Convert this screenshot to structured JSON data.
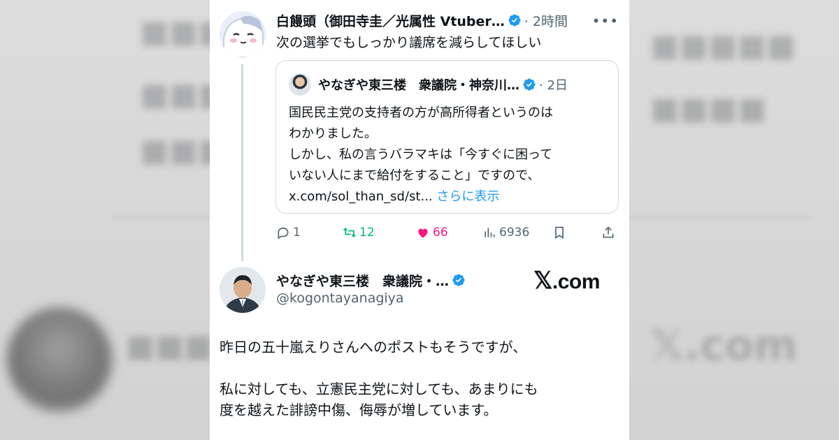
{
  "reply": {
    "author": "白饅頭（御田寺圭／光属性 Vtuber…",
    "time": "· 2時間",
    "text": "次の選挙でもしっかり議席を減らしてほしい"
  },
  "quote": {
    "author": "やなぎや東三楼　衆議院・神奈川…",
    "time": "· 2日",
    "lines": [
      "国民民主党の支持者の方が高所得者というのは",
      "わかりました。",
      "しかし、私の言うバラマキは「今すぐに困って",
      "いない人にまで給付をすること」ですので、"
    ],
    "link_text": "x.com/sol_than_sd/st...",
    "show_more": "さらに表示"
  },
  "actions": {
    "replies": "1",
    "retweets": "12",
    "likes": "66",
    "views": "6936"
  },
  "post": {
    "author": "やなぎや東三楼　衆議院・…",
    "handle": "@kogontayanagiya",
    "brand": ".com",
    "lines": [
      "昨日の五十嵐えりさんへのポストもそうですが、",
      "私に対しても、立憲民主党に対しても、あまりにも",
      "度を越えた誹謗中傷、侮辱が増しています。"
    ]
  },
  "colors": {
    "accent": "#1d9bf0",
    "retweet": "#00ba7c",
    "like": "#f91880",
    "muted": "#536471",
    "border": "#cfd9de"
  }
}
